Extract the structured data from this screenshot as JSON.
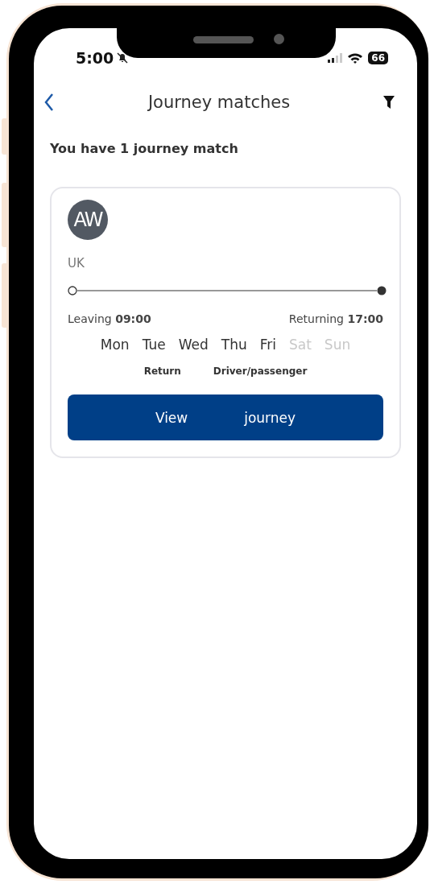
{
  "status_bar": {
    "time": "5:00",
    "battery": "66"
  },
  "header": {
    "title": "Journey matches"
  },
  "summary": "You have 1 journey match",
  "matches": [
    {
      "initials": "AW",
      "location": "UK",
      "leaving_label": "Leaving",
      "leaving_time": "09:00",
      "returning_label": "Returning",
      "returning_time": "17:00",
      "days": [
        {
          "label": "Mon",
          "active": true
        },
        {
          "label": "Tue",
          "active": true
        },
        {
          "label": "Wed",
          "active": true
        },
        {
          "label": "Thu",
          "active": true
        },
        {
          "label": "Fri",
          "active": true
        },
        {
          "label": "Sat",
          "active": false
        },
        {
          "label": "Sun",
          "active": false
        }
      ],
      "tags": [
        "Return",
        "Driver/passenger"
      ],
      "button_words": [
        "View",
        "journey"
      ]
    }
  ]
}
